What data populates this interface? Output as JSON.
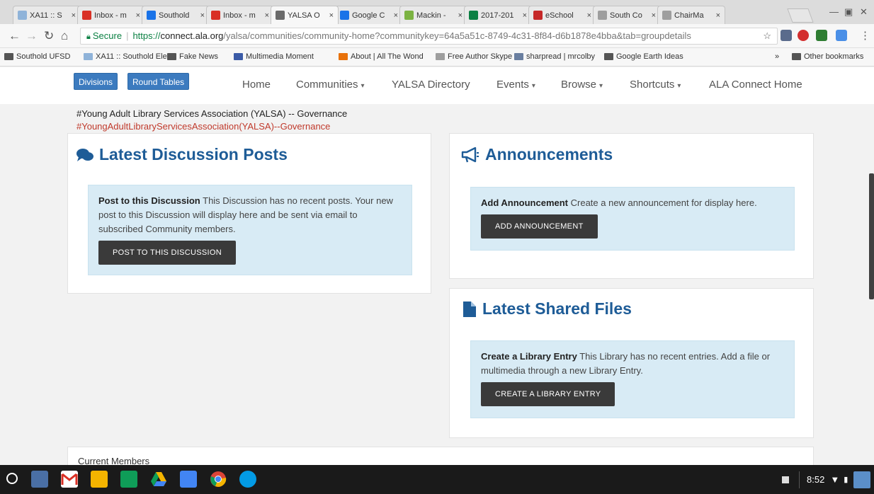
{
  "browser": {
    "tabs": [
      {
        "title": "XA11 :: S",
        "icon_color": "#8fb3d9"
      },
      {
        "title": "Inbox - m",
        "icon_color": "#d93025"
      },
      {
        "title": "Southold",
        "icon_color": "#1a73e8"
      },
      {
        "title": "Inbox - m",
        "icon_color": "#d93025"
      },
      {
        "title": "YALSA O",
        "icon_color": "#6b6b6b"
      },
      {
        "title": "Google C",
        "icon_color": "#1a73e8"
      },
      {
        "title": "Mackin -",
        "icon_color": "#7cb342"
      },
      {
        "title": "2017-201",
        "icon_color": "#0b8043"
      },
      {
        "title": "eSchool",
        "icon_color": "#c62828"
      },
      {
        "title": "South Co",
        "icon_color": "#9e9e9e"
      },
      {
        "title": "ChairMa",
        "icon_color": "#9e9e9e"
      }
    ],
    "close_glyph": "×",
    "address": {
      "secure_label": "Secure",
      "scheme": "https://",
      "host": "connect.ala.org",
      "path": "/yalsa/communities/community-home?communitykey=64a5a51c-8749-4c31-8f84-d6b1878e4bba&tab=groupdetails"
    },
    "bookmarks": [
      "Southold UFSD",
      "XA11 :: Southold Ele",
      "Fake News",
      "Multimedia Moment",
      "About | All The Wond",
      "Free Author Skype",
      "sharpread | mrcolby",
      "Google Earth Ideas"
    ],
    "bookmarks_overflow": "»",
    "other_bookmarks": "Other bookmarks"
  },
  "site": {
    "pills": [
      "Divisions",
      "Round Tables"
    ],
    "nav": [
      {
        "label": "Home",
        "dropdown": false
      },
      {
        "label": "Communities",
        "dropdown": true
      },
      {
        "label": "YALSA Directory",
        "dropdown": false
      },
      {
        "label": "Events",
        "dropdown": true
      },
      {
        "label": "Browse",
        "dropdown": true
      },
      {
        "label": "Shortcuts",
        "dropdown": true
      },
      {
        "label": "ALA Connect Home",
        "dropdown": false
      }
    ],
    "crumb_black": "#Young Adult Library Services Association (YALSA) -- Governance",
    "crumb_red": "#YoungAdultLibraryServicesAssociation(YALSA)--Governance"
  },
  "discussion": {
    "title": "Latest Discussion Posts",
    "lead": "Post to this Discussion",
    "text": " This Discussion has no recent posts. Your new post to this Discussion will display here and be sent via email to subscribed Community members.",
    "button": "POST TO THIS DISCUSSION"
  },
  "announcements": {
    "title": "Announcements",
    "lead": "Add Announcement",
    "text": " Create a new announcement for display here.",
    "button": "ADD ANNOUNCEMENT"
  },
  "files": {
    "title": "Latest Shared Files",
    "lead": "Create a Library Entry",
    "text": " This Library has no recent entries. Add a file or multimedia through a new Library Entry.",
    "button": "CREATE A LIBRARY ENTRY"
  },
  "members": {
    "title": "Current Members"
  },
  "shelf": {
    "time": "8:52"
  }
}
